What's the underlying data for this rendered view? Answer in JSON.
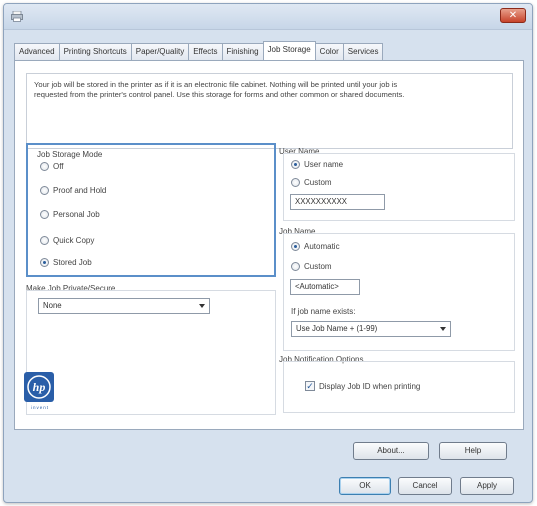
{
  "window": {
    "close_label": "✕"
  },
  "tabs": [
    {
      "label": "Advanced",
      "active": false
    },
    {
      "label": "Printing Shortcuts",
      "active": false
    },
    {
      "label": "Paper/Quality",
      "active": false
    },
    {
      "label": "Effects",
      "active": false
    },
    {
      "label": "Finishing",
      "active": false
    },
    {
      "label": "Job Storage",
      "active": true
    },
    {
      "label": "Color",
      "active": false
    },
    {
      "label": "Services",
      "active": false
    }
  ],
  "description": {
    "line1": "Your job will be stored in the printer as if it is an electronic file cabinet. Nothing will be printed until your job is",
    "line2": "requested from the printer's control panel. Use this storage for forms and other common or shared documents."
  },
  "job_storage_mode": {
    "label": "Job Storage Mode",
    "options": [
      {
        "label": "Off",
        "selected": false
      },
      {
        "label": "Proof and Hold",
        "selected": false
      },
      {
        "label": "Personal Job",
        "selected": false
      },
      {
        "label": "Quick Copy",
        "selected": false
      },
      {
        "label": "Stored Job",
        "selected": true
      }
    ]
  },
  "private_secure": {
    "label": "Make Job Private/Secure",
    "value": "None"
  },
  "user_name": {
    "label": "User Name",
    "option_user": "User name",
    "option_custom": "Custom",
    "value": "XXXXXXXXXX"
  },
  "job_name": {
    "label": "Job Name",
    "option_automatic": "Automatic",
    "option_custom": "Custom",
    "value": "<Automatic>",
    "exists_label": "If job name exists:",
    "exists_value": "Use Job Name + (1-99)"
  },
  "notification": {
    "label": "Job Notification Options",
    "checkbox_label": "Display Job ID when printing",
    "checked": true
  },
  "buttons": {
    "about": "About...",
    "help": "Help",
    "ok": "OK",
    "cancel": "Cancel",
    "apply": "Apply"
  },
  "logo": {
    "text": "hp",
    "tagline": "invent"
  },
  "colors": {
    "accent": "#5b8fc9",
    "hp_blue": "#2a5ea8",
    "close_red": "#c7432b"
  }
}
